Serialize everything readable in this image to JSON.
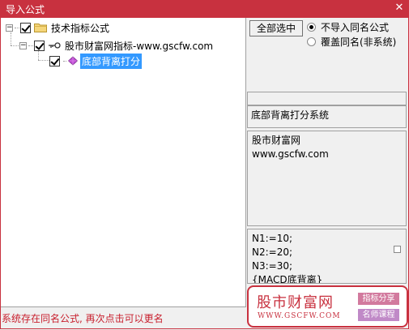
{
  "window": {
    "title": "导入公式",
    "close_glyph": "✕",
    "accent_color": "#c8313f"
  },
  "tree": {
    "root": {
      "label": "技术指标公式",
      "checked": true,
      "icon": "folder-icon"
    },
    "child": {
      "label": "股市财富网指标-www.gscfw.com",
      "checked": true,
      "icon": "key-icon"
    },
    "leaf": {
      "label": "底部背离打分",
      "checked": true,
      "icon": "gem-icon",
      "selected": true
    }
  },
  "options": {
    "select_all_label": "全部选中",
    "no_import_label": "不导入同名公式",
    "overwrite_label": "覆盖同名(非系统)",
    "selected": "no_import"
  },
  "formula_name": "底部背离打分系统",
  "description": "股市财富网\nwww.gscfw.com",
  "source_code": "N1:=10;\nN2:=20;\nN3:=30;\n{MACD底背离}",
  "status_message": "系统存在同名公式, 再次点击可以更名",
  "promo": {
    "brand": "股市财富网",
    "site": "WWW.GSCFW.COM",
    "tag1": "指标分享",
    "tag2": "名师课程"
  }
}
